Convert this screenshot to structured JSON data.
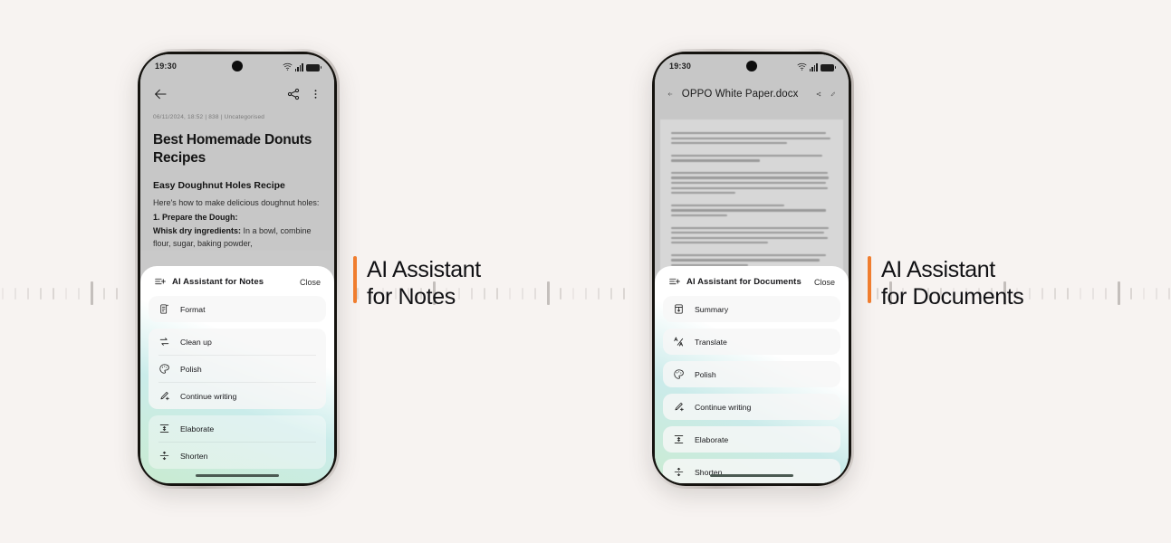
{
  "page": {
    "background": "#f7f3f1",
    "accent": "#f07d2e"
  },
  "ruler": {
    "name": "ruler-ticks"
  },
  "phone_left": {
    "status": {
      "time": "19:30",
      "wifi_icon": "wifi-icon",
      "signal_icon": "signal-icon",
      "battery_icon": "battery-icon"
    },
    "header": {
      "back_icon": "back-arrow-icon",
      "share_icon": "share-icon",
      "more_icon": "more-vertical-icon"
    },
    "note": {
      "meta": "06/11/2024, 18:52  |  838  |  Uncategorised",
      "title": "Best Homemade Donuts Recipes",
      "heading": "Easy Doughnut Holes Recipe",
      "para1": "Here's how to make delicious doughnut holes:",
      "step_title": "1. Prepare the Dough:",
      "step_lead": "Whisk dry ingredients:",
      "step_rest": " In a bowl, combine flour, sugar, baking powder,"
    },
    "ai_panel": {
      "icon": "ai-assistant-icon",
      "title": "AI Assistant for Notes",
      "close_label": "Close",
      "groups": [
        {
          "items": [
            {
              "label": "Format",
              "icon": "format-icon"
            }
          ]
        },
        {
          "items": [
            {
              "label": "Clean up",
              "icon": "clean-up-icon"
            },
            {
              "label": "Polish",
              "icon": "polish-palette-icon"
            },
            {
              "label": "Continue writing",
              "icon": "continue-writing-pencil-icon"
            }
          ]
        },
        {
          "items": [
            {
              "label": "Elaborate",
              "icon": "elaborate-expand-icon"
            },
            {
              "label": "Shorten",
              "icon": "shorten-collapse-icon"
            }
          ]
        }
      ]
    }
  },
  "phone_right": {
    "status": {
      "time": "19:30",
      "wifi_icon": "wifi-icon",
      "signal_icon": "signal-icon",
      "battery_icon": "battery-icon"
    },
    "header": {
      "back_icon": "back-arrow-icon",
      "title": "OPPO White Paper.docx",
      "share_icon": "share-icon",
      "edit_icon": "edit-pencil-icon"
    },
    "ai_panel": {
      "icon": "ai-assistant-icon",
      "title": "AI Assistant for Documents",
      "close_label": "Close",
      "groups": [
        {
          "items": [
            {
              "label": "Summary",
              "icon": "summary-doc-icon"
            }
          ]
        },
        {
          "items": [
            {
              "label": "Translate",
              "icon": "translate-icon"
            }
          ]
        },
        {
          "items": [
            {
              "label": "Polish",
              "icon": "polish-palette-icon"
            }
          ]
        },
        {
          "items": [
            {
              "label": "Continue writing",
              "icon": "continue-writing-pencil-icon"
            }
          ]
        },
        {
          "items": [
            {
              "label": "Elaborate",
              "icon": "elaborate-expand-icon"
            }
          ]
        },
        {
          "items": [
            {
              "label": "Shorten",
              "icon": "shorten-collapse-icon"
            }
          ]
        }
      ]
    }
  },
  "callouts": {
    "left": "AI Assistant\nfor Notes",
    "right": "AI Assistant\nfor Documents"
  }
}
